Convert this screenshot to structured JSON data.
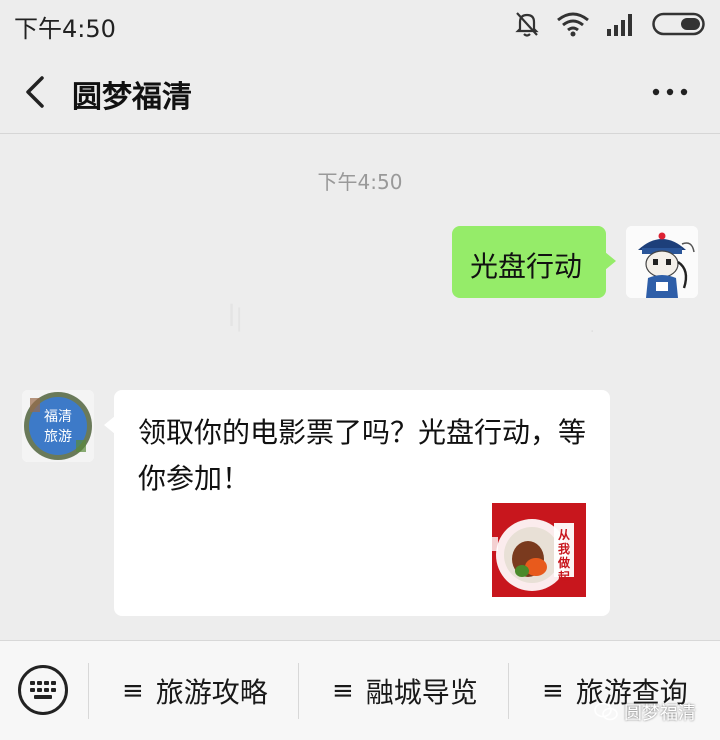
{
  "status_bar": {
    "time": "下午4:50",
    "icons": [
      "mute-bell-icon",
      "wifi-icon",
      "signal-icon",
      "battery-icon"
    ]
  },
  "header": {
    "title": "圆梦福清",
    "back_icon": "chevron-left-icon",
    "more_icon": "more-dots-icon"
  },
  "chat": {
    "timestamp": "下午4:50",
    "messages": [
      {
        "from": "me",
        "text": "光盘行动"
      },
      {
        "from": "account",
        "avatar_text": "福清\n旅游",
        "text": "领取你的电影票了吗？光盘行动，等你参加！",
        "thumbnail_text": "从我做起"
      }
    ]
  },
  "bottom_menu": {
    "items": [
      {
        "label": "旅游攻略"
      },
      {
        "label": "融城导览"
      },
      {
        "label": "旅游查询"
      }
    ],
    "menu_glyph": "≡",
    "watermark": "圆梦福清"
  },
  "colors": {
    "sent_bubble": "#95ec69",
    "background": "#ededed",
    "thumbnail_red": "#c8161d"
  }
}
